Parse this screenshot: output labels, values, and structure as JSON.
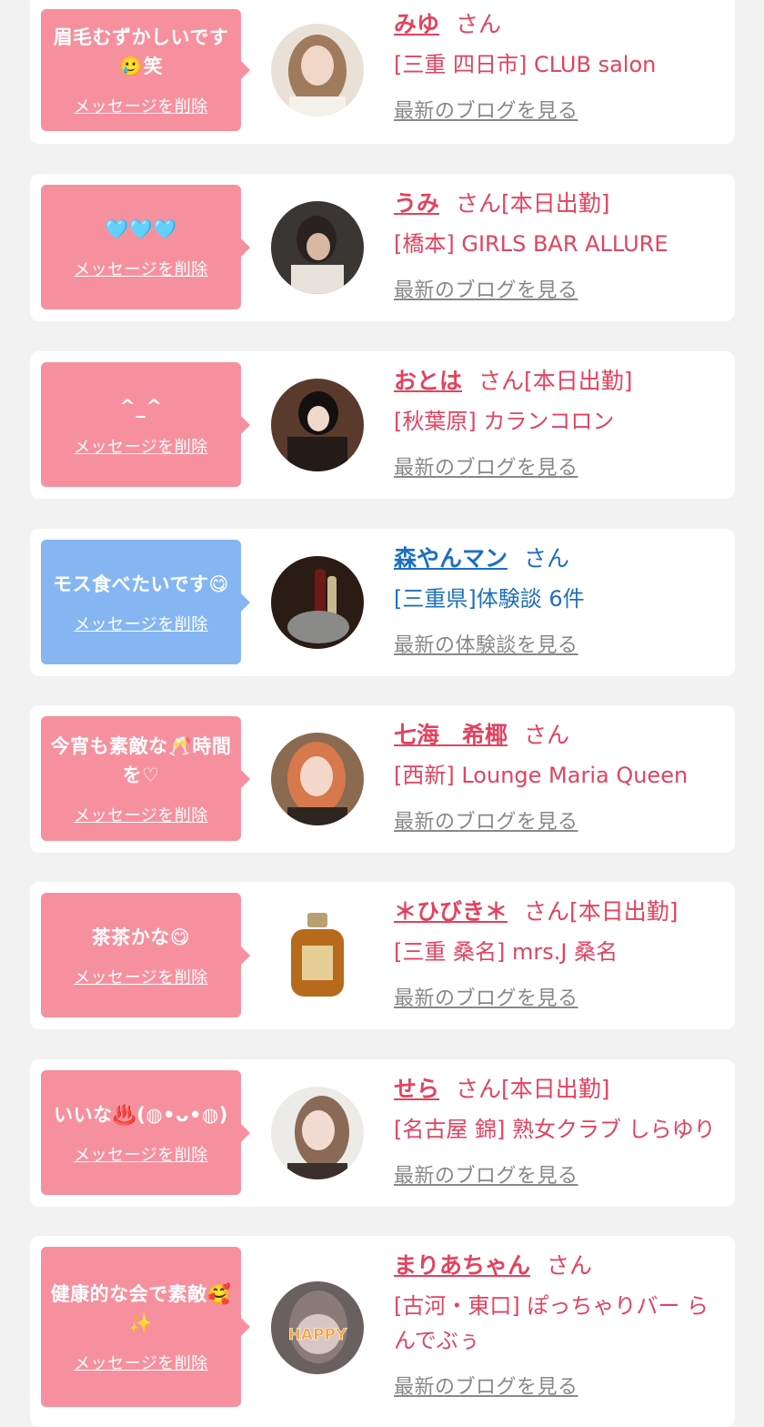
{
  "colors": {
    "page_bg": "#f2f2f2",
    "card_bg": "#ffffff",
    "pink_bubble": "#f7909e",
    "blue_bubble": "#86b6f2",
    "pink_text": "#e2435f",
    "blue_text": "#1d6fc0",
    "link_gray": "#888888"
  },
  "messages": [
    {
      "message": "眉毛むずかしいです🥲笑",
      "delete_label": "メッセージを削除",
      "name": "みゆ",
      "honorific": "さん",
      "status": "",
      "shop": "[三重 四日市] CLUB salon",
      "link": "最新のブログを見る",
      "avatar_icon": "profile-photo"
    },
    {
      "message": "🩵🩵🩵",
      "delete_label": "メッセージを削除",
      "name": "うみ",
      "honorific": "さん",
      "status": "[本日出勤]",
      "shop": "[橋本] GIRLS BAR ALLURE",
      "link": "最新のブログを見る",
      "avatar_icon": "profile-photo"
    },
    {
      "message": "^_^",
      "delete_label": "メッセージを削除",
      "name": "おとは",
      "honorific": "さん",
      "status": "[本日出勤]",
      "shop": "[秋葉原] カランコロン",
      "link": "最新のブログを見る",
      "avatar_icon": "profile-photo"
    },
    {
      "message": "モス食べたいです😋",
      "delete_label": "メッセージを削除",
      "name": "森やんマン",
      "honorific": "さん",
      "status": "",
      "shop": "[三重県]体験談 6件",
      "link": "最新の体験談を見る",
      "avatar_icon": "bottle-photo"
    },
    {
      "message": "今宵も素敵な🥂時間を♡",
      "delete_label": "メッセージを削除",
      "name": "七海　希椰",
      "honorific": "さん",
      "status": "",
      "shop": "[西新] Lounge Maria Queen",
      "link": "最新のブログを見る",
      "avatar_icon": "profile-photo"
    },
    {
      "message": "茶茶かな😋",
      "delete_label": "メッセージを削除",
      "name": "＊ひびき＊",
      "honorific": "さん",
      "status": "[本日出勤]",
      "shop": "[三重 桑名] mrs.J 桑名",
      "link": "最新のブログを見る",
      "avatar_icon": "whisky-bottle"
    },
    {
      "message": "いいな♨️(◍•ᴗ•◍)",
      "delete_label": "メッセージを削除",
      "name": "せら",
      "honorific": "さん",
      "status": "[本日出勤]",
      "shop": "[名古屋 錦] 熟女クラブ しらゆり",
      "link": "最新のブログを見る",
      "avatar_icon": "profile-photo"
    },
    {
      "message": "健康的な会で素敵🥰✨",
      "delete_label": "メッセージを削除",
      "name": "まりあちゃん",
      "honorific": "さん",
      "status": "",
      "shop": "[古河・東口] ぽっちゃりバー らんでぶぅ",
      "link": "最新のブログを見る",
      "avatar_icon": "profile-photo",
      "avatar_text": "HAPPY"
    }
  ]
}
